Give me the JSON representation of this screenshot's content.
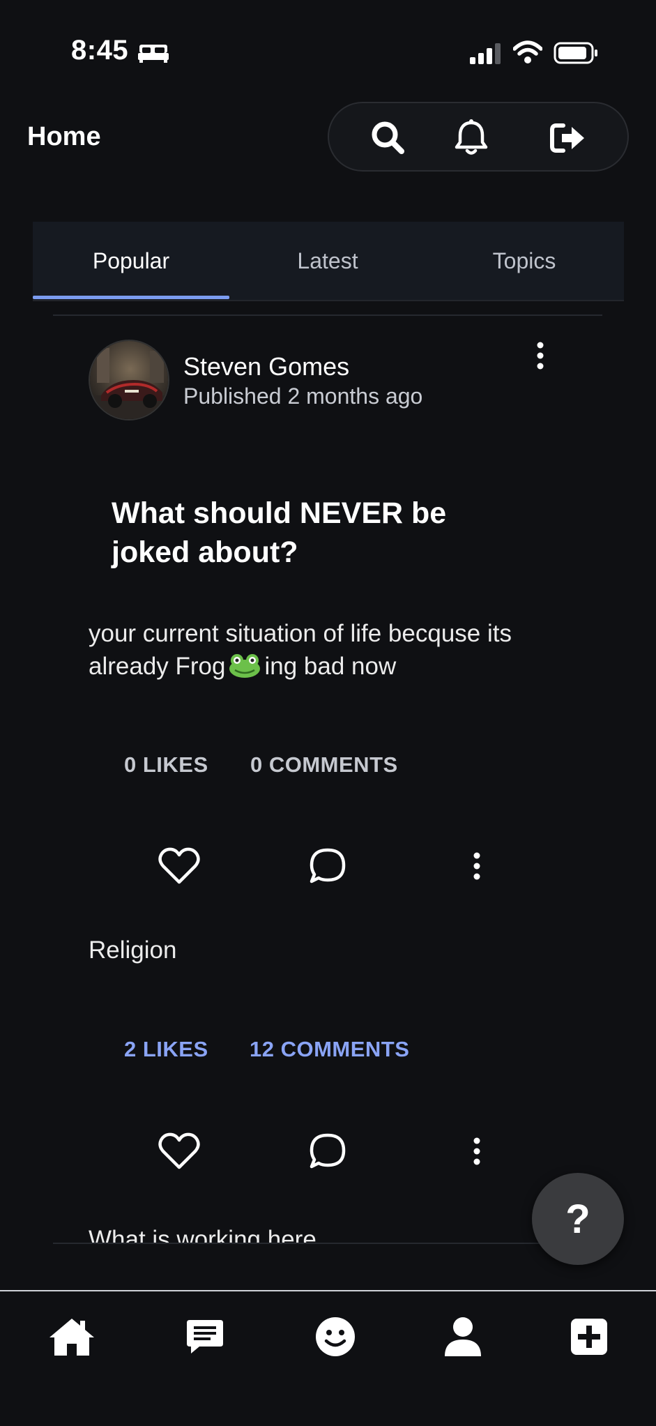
{
  "status_bar": {
    "time": "8:45"
  },
  "header": {
    "title": "Home"
  },
  "tabs": [
    {
      "label": "Popular",
      "active": true
    },
    {
      "label": "Latest",
      "active": false
    },
    {
      "label": "Topics",
      "active": false
    }
  ],
  "post": {
    "author": "Steven Gomes",
    "published": "Published 2 months ago",
    "title": "What should NEVER be joked about?",
    "body_before_emoji": "your current situation of life becquse its already Frog",
    "body_after_emoji": "ing bad now",
    "likes": "0 LIKES",
    "comments": "0 COMMENTS"
  },
  "post2": {
    "topic": "Religion",
    "likes": "2 LIKES",
    "comments": "12 COMMENTS",
    "partial_text": "What is working here"
  },
  "help_button": {
    "label": "?"
  },
  "colors": {
    "background": "#0f1013",
    "accent": "#7b9cf0",
    "stat_blue": "#8aa4f5"
  }
}
